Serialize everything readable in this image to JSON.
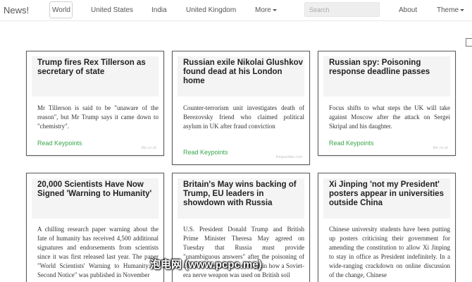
{
  "navbar": {
    "brand": "News!",
    "links": [
      "World",
      "United States",
      "India",
      "United Kingdom"
    ],
    "more_label": "More",
    "search_placeholder": "Search",
    "about_label": "About",
    "theme_label": "Theme"
  },
  "cards": [
    {
      "title": "Trump fires Rex Tillerson as secretary of state",
      "body": "Mr Tillerson is said to be \"unaware of the reason\", but Mr Trump says it came down to \"chemistry\".",
      "link_label": "Read Keypoints",
      "source": "bbc.co.uk"
    },
    {
      "title": "Russian exile Nikolai Glushkov found dead at his London home",
      "body": "Counter-terrorism unit investigates death of Berezovsky friend who claimed political asylum in UK after fraud conviction",
      "link_label": "Read Keypoints",
      "source": "theguardian.com"
    },
    {
      "title": "Russian spy: Poisoning response deadline passes",
      "body": "Focus shifts to what steps the UK will take against Moscow after the attack on Sergei Skripal and his daughter.",
      "link_label": "Read Keypoints",
      "source": "bbc.co.uk"
    },
    {
      "title": "20,000 Scientists Have Now Signed 'Warning to Humanity'",
      "body": "A chilling research paper warning about the fate of humanity has received 4,500 additional signatures and endorsements from scientists since it was first released last year. The paper \"World Scientists' Warning to Humanity: A Second Notice\" was published in November"
    },
    {
      "title": "Britain's May wins backing of Trump, EU leaders in showdown with Russia",
      "body": "U.S. President Donald Trump and British Prime Minister Theresa May agreed on Tuesday that Russia must provide \"unambiguous answers\" after the poisoning of a former spy and need to explain how a Soviet-era nerve weapon was used on British soil"
    },
    {
      "title": "Xi Jinping 'not my President' posters appear in universities outside China",
      "body": "Chinese university students have been putting up posters criticising their government for amending the constitution to allow Xi Jinping to stay in office as President indefinitely. In a wide-ranging crackdown on online discussion of the change, Chinese"
    }
  ],
  "watermark": "泡电网 (www.pcpc.me)"
}
